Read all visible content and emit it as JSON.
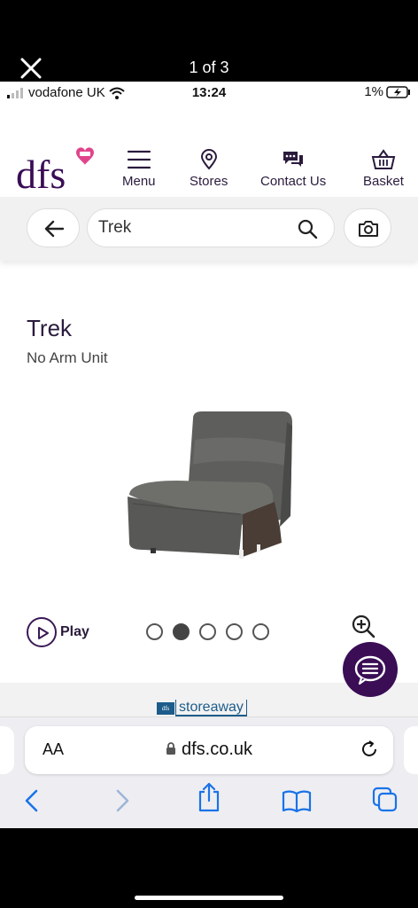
{
  "viewer": {
    "counter": "1 of 3"
  },
  "status": {
    "carrier": "vodafone UK",
    "time": "13:24",
    "battery": "1%"
  },
  "brand": {
    "logo": "dfs"
  },
  "nav": [
    {
      "label": "Menu",
      "icon": "hamburger-icon"
    },
    {
      "label": "Stores",
      "icon": "location-pin-icon"
    },
    {
      "label": "Contact Us",
      "icon": "chat-bubbles-icon"
    },
    {
      "label": "Basket",
      "icon": "basket-icon"
    }
  ],
  "search": {
    "value": "Trek"
  },
  "product": {
    "title": "Trek",
    "subtitle": "No Arm Unit"
  },
  "media": {
    "play_label": "Play",
    "dot_count": 5,
    "active_dot": 1
  },
  "storeaway": {
    "mini": "dfs",
    "word": "storeaway"
  },
  "safari": {
    "aa": "AA",
    "host": "dfs.co.uk"
  },
  "colors": {
    "brand_purple": "#3a0d55",
    "logo_pink": "#e0458b",
    "safari_blue": "#1a73e8"
  }
}
